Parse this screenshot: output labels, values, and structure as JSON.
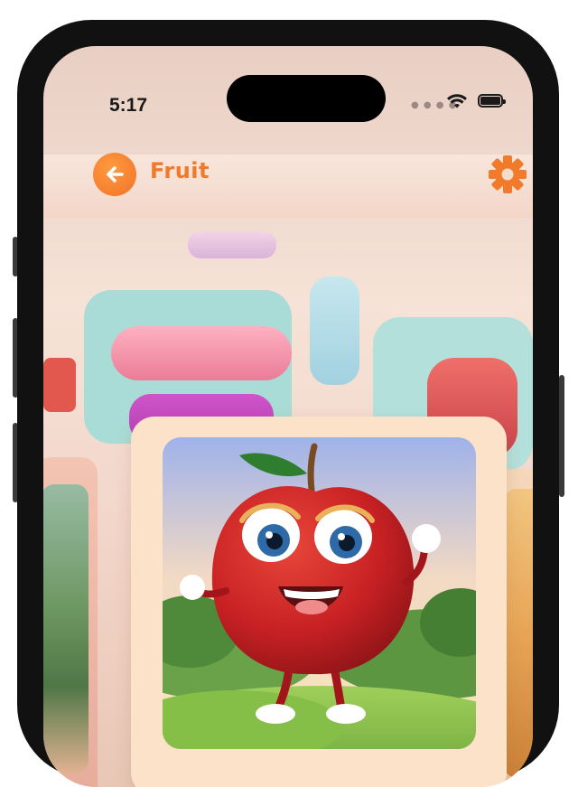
{
  "status_bar": {
    "time": "5:17",
    "signal_icon": "signal-dots-icon",
    "wifi_icon": "wifi-icon",
    "battery_icon": "battery-icon"
  },
  "header": {
    "back_icon": "arrow-left-icon",
    "title": "Fruit",
    "settings_icon": "gear-icon"
  },
  "carousel": {
    "current_card": {
      "image": "apple-character-illustration"
    }
  },
  "colors": {
    "accent": "#f07a2a",
    "card_background": "#fbe2c9"
  }
}
